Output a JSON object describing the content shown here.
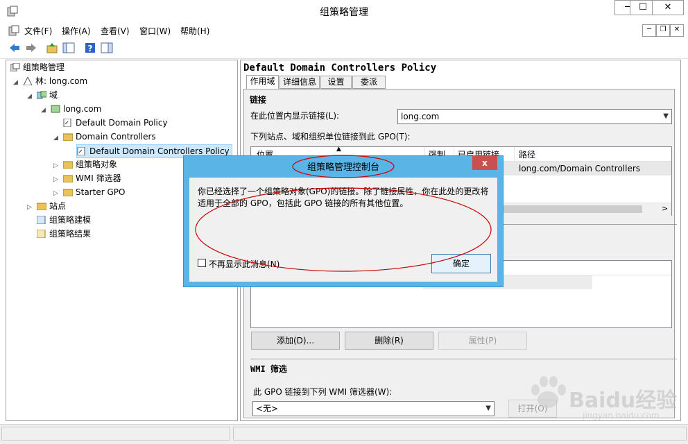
{
  "window": {
    "title": "组策略管理",
    "minimize": "─",
    "maximize": "☐",
    "close": "✕"
  },
  "menu": [
    "文件(F)",
    "操作(A)",
    "查看(V)",
    "窗口(W)",
    "帮助(H)"
  ],
  "tree": {
    "root": "组策略管理",
    "forest": "林: long.com",
    "domains": "域",
    "domain": "long.com",
    "default_domain_policy": "Default Domain Policy",
    "domain_controllers": "Domain Controllers",
    "ddcp": "Default Domain Controllers Policy",
    "gpo_objects": "组策略对象",
    "wmi_filters": "WMI 筛选器",
    "starter_gpo": "Starter GPO",
    "sites": "站点",
    "modeling": "组策略建模",
    "results": "组策略结果"
  },
  "details": {
    "heading": "Default Domain Controllers Policy",
    "tabs": [
      "作用域",
      "详细信息",
      "设置",
      "委派"
    ],
    "links_label": "链接",
    "show_links_label": "在此位置内显示链接(L):",
    "show_links_value": "long.com",
    "linked_label": "下列站点、域和组织单位链接到此 GPO(T):",
    "columns": {
      "location": "位置",
      "enforced": "强制",
      "enabled": "已启用链接",
      "path": "路径"
    },
    "row_path": "long.com/Domain Controllers",
    "add_button": "添加(D)...",
    "delete_button": "删除(R)",
    "properties_button": "属性(P)",
    "wmi_label": "WMI 筛选",
    "wmi_link_label": "此 GPO 链接到下列 WMI 筛选器(W):",
    "wmi_value": "<无>",
    "open_button": "打开(O)"
  },
  "dialog": {
    "title": "组策略管理控制台",
    "close": "x",
    "message_line1": "你已经选择了一个组策略对象(GPO)的链接。除了链接属性，你在此处的更改将",
    "message_line2": "适用于全部的 GPO，包括此 GPO 链接的所有其他位置。",
    "checkbox_label": "不再显示此消息(N)",
    "ok_button": "确定"
  },
  "annotation_color": "#cc0000",
  "watermark": {
    "brand": "Baidu经验",
    "url": "jingyan.baidu.com"
  }
}
